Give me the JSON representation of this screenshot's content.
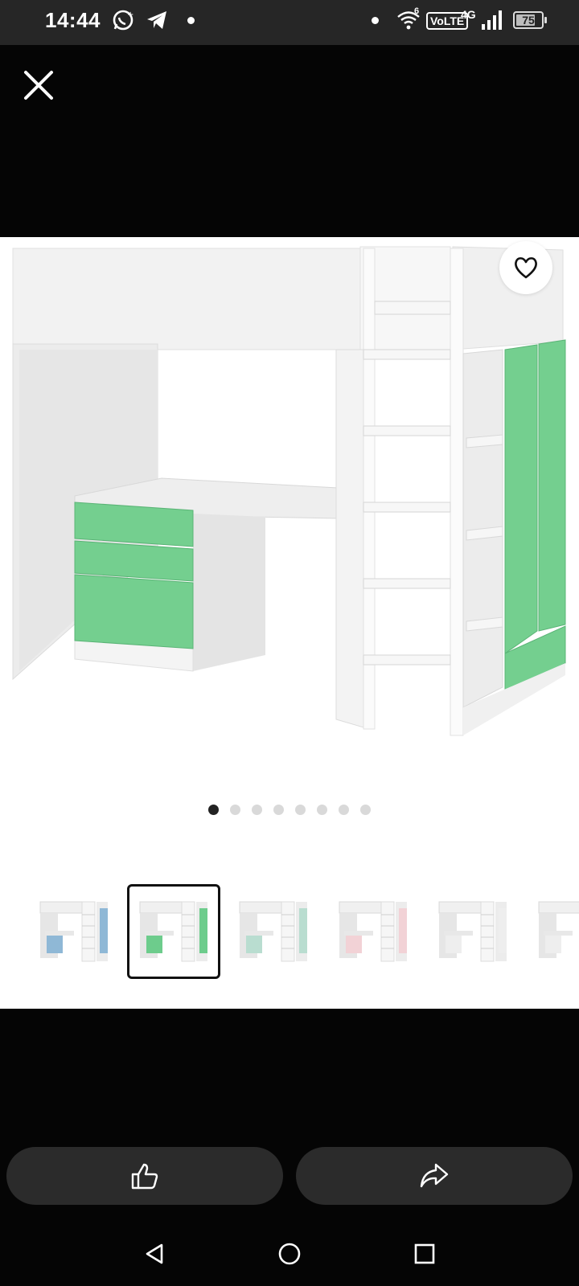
{
  "status_bar": {
    "time": "14:44",
    "signal_label": "VoLTE",
    "network": "4G",
    "wifi_sup": "6",
    "battery": "75",
    "battery_level": 0.75,
    "icons": [
      "whatsapp-icon",
      "telegram-icon",
      "wifi-icon",
      "volte-icon",
      "signal-icon",
      "battery-icon"
    ]
  },
  "viewer": {
    "close_icon": "close-icon",
    "favorite_icon": "heart-icon",
    "image_count": 8,
    "active_index": 0,
    "selected_thumbnail": 1,
    "thumbnails": [
      {
        "color_name": "blue",
        "accent": "#8fb8d6"
      },
      {
        "color_name": "green",
        "accent": "#6dcc8c"
      },
      {
        "color_name": "mint",
        "accent": "#b9ddd0"
      },
      {
        "color_name": "pink",
        "accent": "#f2d2d6"
      },
      {
        "color_name": "white",
        "accent": "#eeeeee"
      },
      {
        "color_name": "white-partial",
        "accent": "#eeeeee"
      }
    ],
    "product_accent": "#74cf8f"
  },
  "actions": {
    "like_icon": "thumbs-up-icon",
    "share_icon": "share-icon"
  },
  "nav": {
    "back_icon": "back-icon",
    "home_icon": "home-icon",
    "recents_icon": "recents-icon"
  }
}
